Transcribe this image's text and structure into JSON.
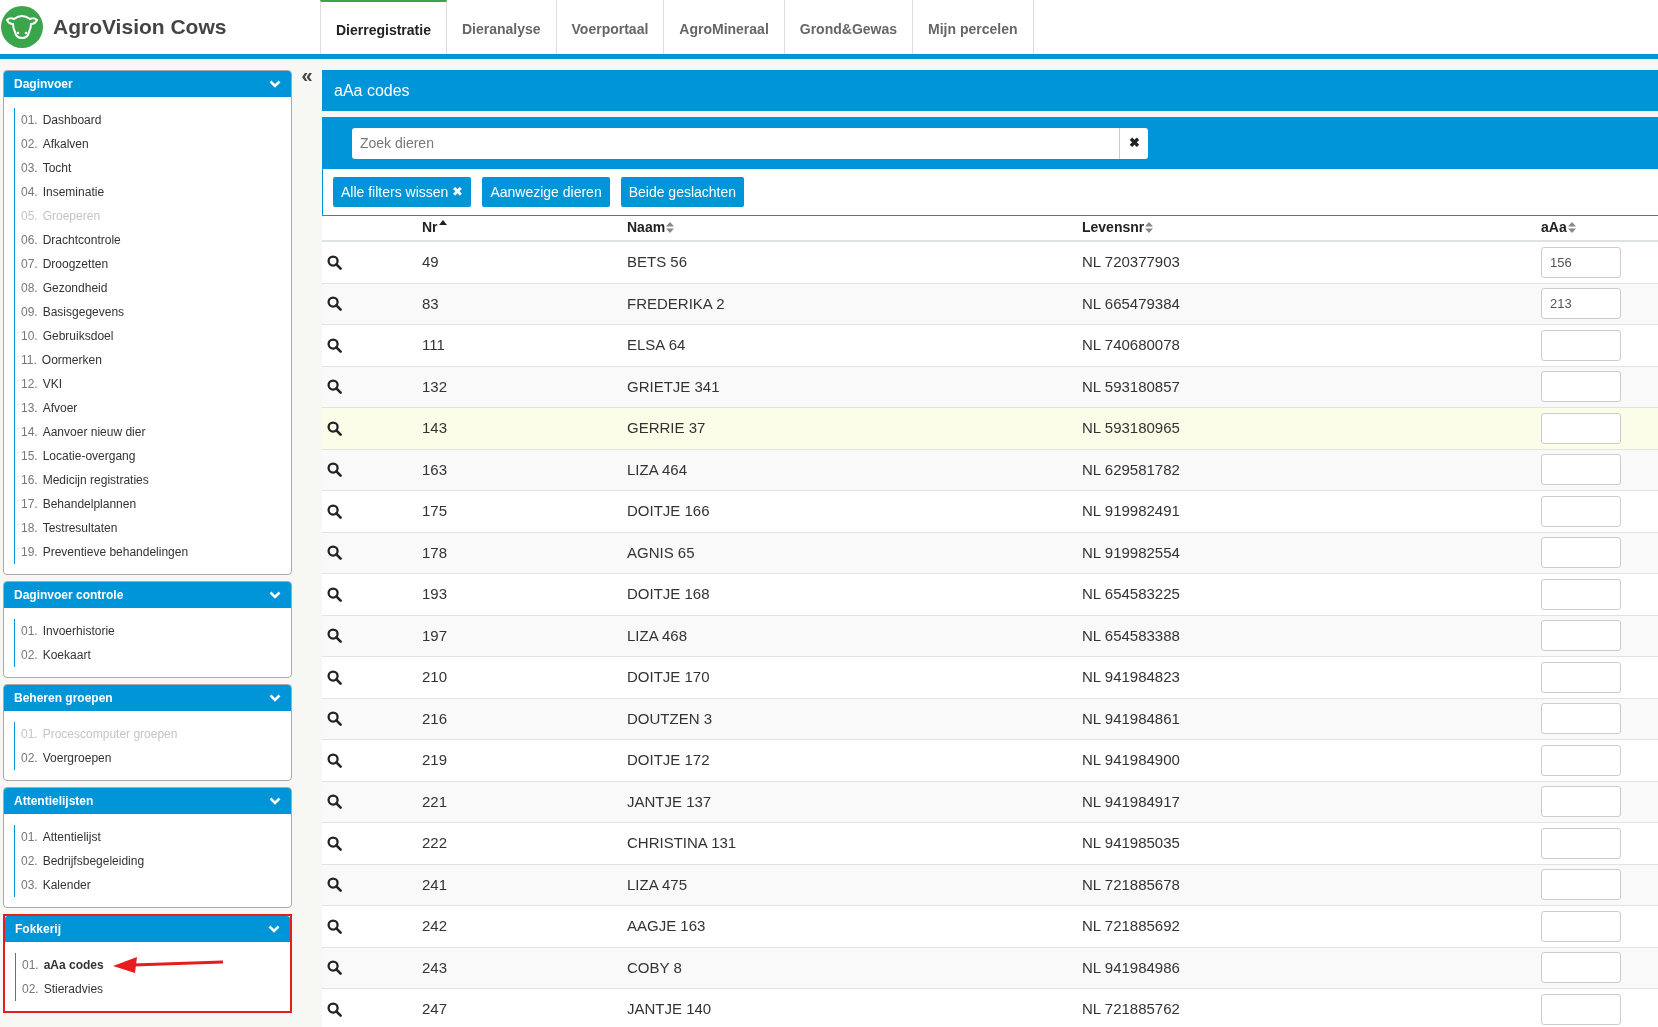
{
  "app": {
    "name": "AgroVision Cows"
  },
  "tabs": [
    {
      "label": "Dierregistratie",
      "selected": true
    },
    {
      "label": "Dieranalyse",
      "selected": false
    },
    {
      "label": "Voerportaal",
      "selected": false
    },
    {
      "label": "AgroMineraal",
      "selected": false
    },
    {
      "label": "Grond&Gewas",
      "selected": false
    },
    {
      "label": "Mijn percelen",
      "selected": false
    }
  ],
  "sidebar": {
    "collapse": "«",
    "sections": [
      {
        "title": "Daginvoer",
        "annotated": false,
        "items": [
          {
            "num": "01.",
            "label": "Dashboard",
            "disabled": false,
            "selected": false
          },
          {
            "num": "02.",
            "label": "Afkalven",
            "disabled": false,
            "selected": false
          },
          {
            "num": "03.",
            "label": "Tocht",
            "disabled": false,
            "selected": false
          },
          {
            "num": "04.",
            "label": "Inseminatie",
            "disabled": false,
            "selected": false
          },
          {
            "num": "05.",
            "label": "Groeperen",
            "disabled": true,
            "selected": false
          },
          {
            "num": "06.",
            "label": "Drachtcontrole",
            "disabled": false,
            "selected": false
          },
          {
            "num": "07.",
            "label": "Droogzetten",
            "disabled": false,
            "selected": false
          },
          {
            "num": "08.",
            "label": "Gezondheid",
            "disabled": false,
            "selected": false
          },
          {
            "num": "09.",
            "label": "Basisgegevens",
            "disabled": false,
            "selected": false
          },
          {
            "num": "10.",
            "label": "Gebruiksdoel",
            "disabled": false,
            "selected": false
          },
          {
            "num": "11.",
            "label": "Oormerken",
            "disabled": false,
            "selected": false
          },
          {
            "num": "12.",
            "label": "VKI",
            "disabled": false,
            "selected": false
          },
          {
            "num": "13.",
            "label": "Afvoer",
            "disabled": false,
            "selected": false
          },
          {
            "num": "14.",
            "label": "Aanvoer nieuw dier",
            "disabled": false,
            "selected": false
          },
          {
            "num": "15.",
            "label": "Locatie-overgang",
            "disabled": false,
            "selected": false
          },
          {
            "num": "16.",
            "label": "Medicijn registraties",
            "disabled": false,
            "selected": false
          },
          {
            "num": "17.",
            "label": "Behandelplannen",
            "disabled": false,
            "selected": false
          },
          {
            "num": "18.",
            "label": "Testresultaten",
            "disabled": false,
            "selected": false
          },
          {
            "num": "19.",
            "label": "Preventieve behandelingen",
            "disabled": false,
            "selected": false
          }
        ]
      },
      {
        "title": "Daginvoer controle",
        "annotated": false,
        "items": [
          {
            "num": "01.",
            "label": "Invoerhistorie",
            "disabled": false,
            "selected": false
          },
          {
            "num": "02.",
            "label": "Koekaart",
            "disabled": false,
            "selected": false
          }
        ]
      },
      {
        "title": "Beheren groepen",
        "annotated": false,
        "items": [
          {
            "num": "01.",
            "label": "Procescomputer groepen",
            "disabled": true,
            "selected": false
          },
          {
            "num": "02.",
            "label": "Voergroepen",
            "disabled": false,
            "selected": false
          }
        ]
      },
      {
        "title": "Attentielijsten",
        "annotated": false,
        "items": [
          {
            "num": "01.",
            "label": "Attentielijst",
            "disabled": false,
            "selected": false
          },
          {
            "num": "02.",
            "label": "Bedrijfsbegeleiding",
            "disabled": false,
            "selected": false
          },
          {
            "num": "03.",
            "label": "Kalender",
            "disabled": false,
            "selected": false
          }
        ]
      },
      {
        "title": "Fokkerij",
        "annotated": true,
        "items": [
          {
            "num": "01.",
            "label": "aAa codes",
            "disabled": false,
            "selected": true
          },
          {
            "num": "02.",
            "label": "Stieradvies",
            "disabled": false,
            "selected": false
          }
        ]
      }
    ]
  },
  "panel": {
    "title": "aAa codes",
    "search": {
      "placeholder": "Zoek dieren",
      "clear": "✖"
    },
    "filters": [
      {
        "label": "Alle filters wissen",
        "clear": true
      },
      {
        "label": "Aanwezige dieren",
        "clear": false
      },
      {
        "label": "Beide geslachten",
        "clear": false
      }
    ]
  },
  "table": {
    "columns": [
      {
        "label": "Nr",
        "sorted": true
      },
      {
        "label": "Naam",
        "sorted": false
      },
      {
        "label": "Levensnr",
        "sorted": false
      },
      {
        "label": "aAa",
        "sorted": false
      }
    ],
    "rows": [
      {
        "nr": "49",
        "naam": "BETS 56",
        "levensnr": "NL 720377903",
        "aaa": "156",
        "highlighted": false
      },
      {
        "nr": "83",
        "naam": "FREDERIKA 2",
        "levensnr": "NL 665479384",
        "aaa": "213",
        "highlighted": false
      },
      {
        "nr": "111",
        "naam": "ELSA 64",
        "levensnr": "NL 740680078",
        "highlighted": false
      },
      {
        "nr": "132",
        "naam": "GRIETJE 341",
        "levensnr": "NL 593180857",
        "highlighted": false
      },
      {
        "nr": "143",
        "naam": "GERRIE 37",
        "levensnr": "NL 593180965",
        "highlighted": true
      },
      {
        "nr": "163",
        "naam": "LIZA 464",
        "levensnr": "NL 629581782",
        "highlighted": false
      },
      {
        "nr": "175",
        "naam": "DOITJE 166",
        "levensnr": "NL 919982491",
        "highlighted": false
      },
      {
        "nr": "178",
        "naam": "AGNIS 65",
        "levensnr": "NL 919982554",
        "highlighted": false
      },
      {
        "nr": "193",
        "naam": "DOITJE 168",
        "levensnr": "NL 654583225",
        "highlighted": false
      },
      {
        "nr": "197",
        "naam": "LIZA 468",
        "levensnr": "NL 654583388",
        "highlighted": false
      },
      {
        "nr": "210",
        "naam": "DOITJE 170",
        "levensnr": "NL 941984823",
        "highlighted": false
      },
      {
        "nr": "216",
        "naam": "DOUTZEN 3",
        "levensnr": "NL 941984861",
        "highlighted": false
      },
      {
        "nr": "219",
        "naam": "DOITJE 172",
        "levensnr": "NL 941984900",
        "highlighted": false
      },
      {
        "nr": "221",
        "naam": "JANTJE 137",
        "levensnr": "NL 941984917",
        "highlighted": false
      },
      {
        "nr": "222",
        "naam": "CHRISTINA 131",
        "levensnr": "NL 941985035",
        "highlighted": false
      },
      {
        "nr": "241",
        "naam": "LIZA 475",
        "levensnr": "NL 721885678",
        "highlighted": false
      },
      {
        "nr": "242",
        "naam": "AAGJE 163",
        "levensnr": "NL 721885692",
        "highlighted": false
      },
      {
        "nr": "243",
        "naam": "COBY 8",
        "levensnr": "NL 941984986",
        "highlighted": false
      },
      {
        "nr": "247",
        "naam": "JANTJE 140",
        "levensnr": "NL 721885762",
        "highlighted": false
      }
    ]
  }
}
